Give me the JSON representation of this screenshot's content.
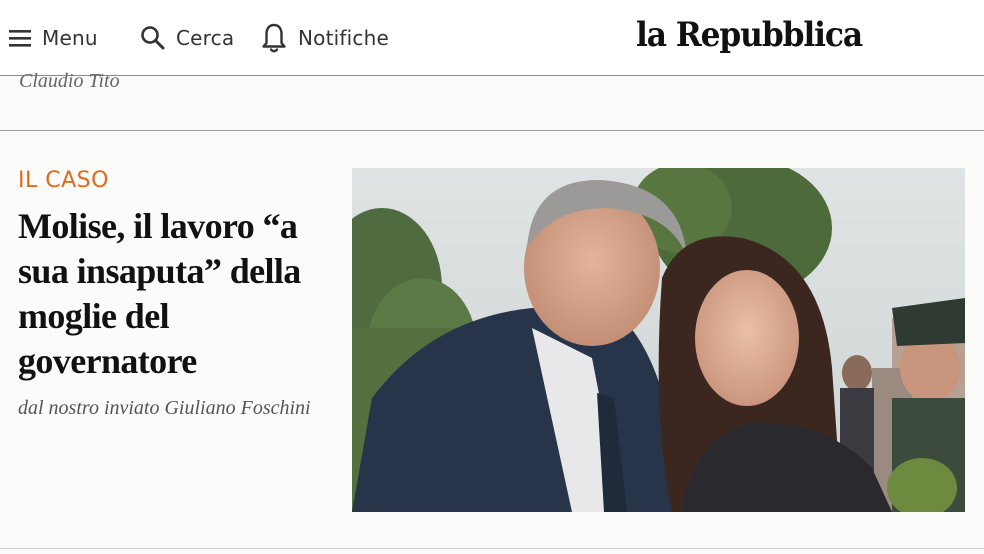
{
  "header": {
    "menu_label": "Menu",
    "search_label": "Cerca",
    "notifications_label": "Notifiche",
    "logo_text": "la Repubblica"
  },
  "previous_article": {
    "author": "Claudio Tito"
  },
  "article": {
    "kicker": "IL CASO",
    "title": "Molise, il lavoro “a sua insaputa” della moglie del governatore",
    "byline": "dal nostro inviato Giuliano Foschini"
  },
  "colors": {
    "kicker": "#e0691c",
    "headline": "#111111",
    "byline": "#555555"
  },
  "icons": [
    "menu-icon",
    "search-icon",
    "bell-icon"
  ]
}
